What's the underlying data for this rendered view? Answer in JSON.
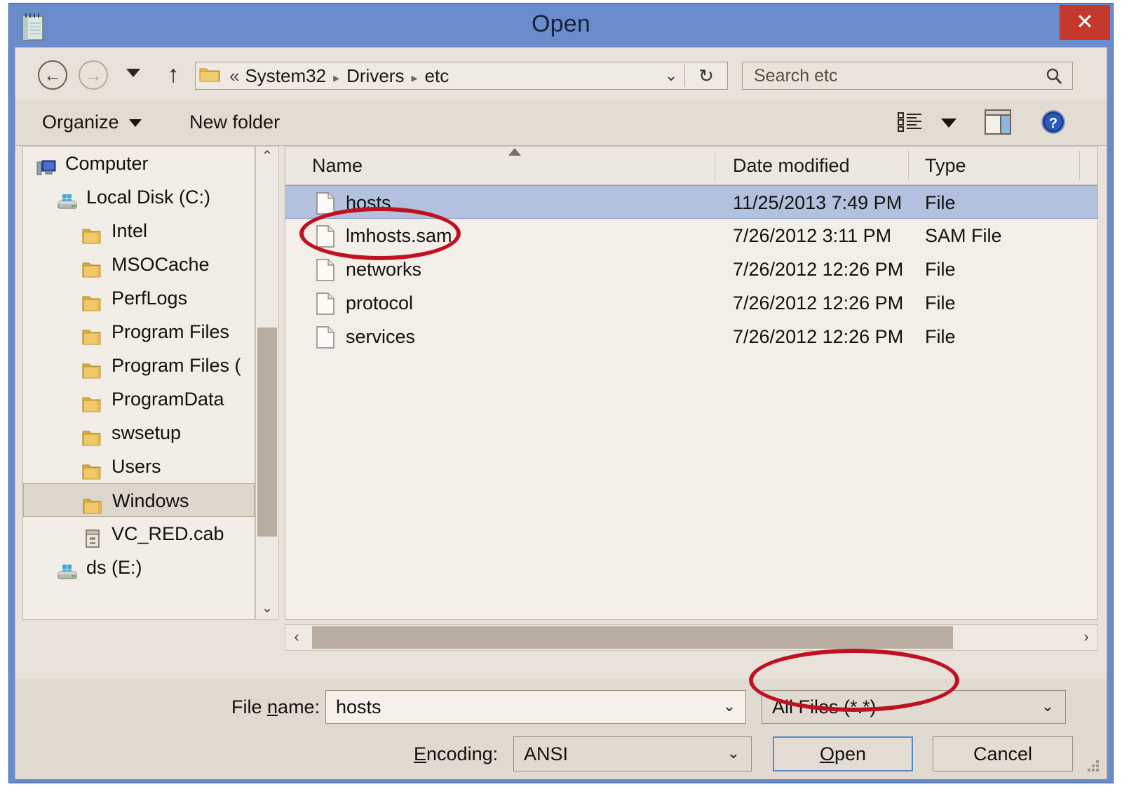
{
  "window": {
    "title": "Open",
    "app_icon": "notepad-icon",
    "close_label": "✕"
  },
  "navbar": {
    "back_glyph": "←",
    "forward_glyph": "→",
    "history_glyph": "▼",
    "up_glyph": "↑",
    "breadcrumb_prefix": "«",
    "breadcrumb": [
      "System32",
      "Drivers",
      "etc"
    ],
    "breadcrumb_separator": "▸",
    "address_dropdown_glyph": "⌄",
    "refresh_glyph": "↻",
    "search_placeholder": "Search etc",
    "search_icon": "magnifier-icon"
  },
  "toolbar": {
    "organize_label": "Organize",
    "new_folder_label": "New folder",
    "view_options_icon": "view-options-icon",
    "view_caret": "▼",
    "preview_pane_icon": "preview-pane-icon",
    "help_icon": "help-icon"
  },
  "sidebar": {
    "items": [
      {
        "label": "Computer",
        "icon": "computer-icon",
        "indent": 18,
        "selected": false
      },
      {
        "label": "Local Disk (C:)",
        "icon": "drive-icon",
        "indent": 48,
        "selected": false
      },
      {
        "label": "Intel",
        "icon": "folder-icon",
        "indent": 84,
        "selected": false
      },
      {
        "label": "MSOCache",
        "icon": "folder-icon",
        "indent": 84,
        "selected": false
      },
      {
        "label": "PerfLogs",
        "icon": "folder-icon",
        "indent": 84,
        "selected": false
      },
      {
        "label": "Program Files",
        "icon": "folder-icon",
        "indent": 84,
        "selected": false
      },
      {
        "label": "Program Files (",
        "icon": "folder-icon",
        "indent": 84,
        "selected": false
      },
      {
        "label": "ProgramData",
        "icon": "folder-icon",
        "indent": 84,
        "selected": false
      },
      {
        "label": "swsetup",
        "icon": "folder-icon",
        "indent": 84,
        "selected": false
      },
      {
        "label": "Users",
        "icon": "folder-icon",
        "indent": 84,
        "selected": false
      },
      {
        "label": "Windows",
        "icon": "folder-icon",
        "indent": 84,
        "selected": true
      },
      {
        "label": "VC_RED.cab",
        "icon": "cab-file-icon",
        "indent": 84,
        "selected": false
      },
      {
        "label": "ds (E:)",
        "icon": "drive-icon",
        "indent": 48,
        "selected": false
      }
    ],
    "scroll_up_glyph": "⌃",
    "scroll_down_glyph": "⌄"
  },
  "file_list": {
    "columns": [
      "Name",
      "Date modified",
      "Type"
    ],
    "sort_indicator": "ascending",
    "rows": [
      {
        "name": "hosts",
        "date": "11/25/2013 7:49 PM",
        "type": "File",
        "selected": true
      },
      {
        "name": "lmhosts.sam",
        "date": "7/26/2012 3:11 PM",
        "type": "SAM File",
        "selected": false
      },
      {
        "name": "networks",
        "date": "7/26/2012 12:26 PM",
        "type": "File",
        "selected": false
      },
      {
        "name": "protocol",
        "date": "7/26/2012 12:26 PM",
        "type": "File",
        "selected": false
      },
      {
        "name": "services",
        "date": "7/26/2012 12:26 PM",
        "type": "File",
        "selected": false
      }
    ],
    "hscroll_left_glyph": "‹",
    "hscroll_right_glyph": "›"
  },
  "bottom": {
    "filename_label_pre": "File ",
    "filename_label_accel": "n",
    "filename_label_post": "ame:",
    "filename_value": "hosts",
    "filetype_value": "All Files  (*.*)",
    "encoding_label_accel": "E",
    "encoding_label_post": "ncoding:",
    "encoding_value": "ANSI",
    "open_label_accel": "O",
    "open_label_post": "pen",
    "cancel_label": "Cancel",
    "dropdown_glyph": "⌄"
  },
  "annotations": {
    "ellipse_color": "#c01122",
    "targets": [
      "hosts-file-row",
      "file-type-combo"
    ]
  }
}
